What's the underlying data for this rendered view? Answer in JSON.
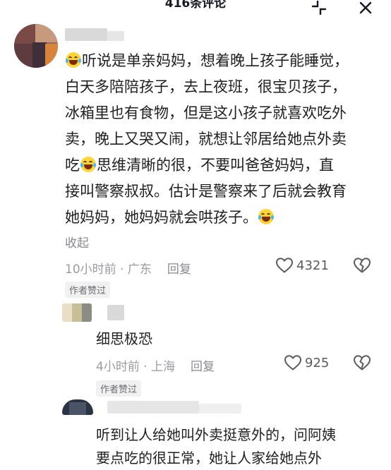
{
  "header": {
    "title": "416条评论"
  },
  "comments": [
    {
      "text_lines": [
        "听说是单亲妈妈，想着晚上孩子能睡觉，",
        "白天多陪陪孩子，去上夜班，很宝贝孩子，",
        "冰箱里也有食物，但是这小孩子就喜欢吃外",
        "卖，晚上又哭又闹，就想让邻居给她点外卖",
        "思维清晰的很，不要叫爸爸妈妈，直",
        "接叫警察叔叔。估计是警察来了后就会教育",
        "她妈妈，她妈妈就会哄孩子。"
      ],
      "text_line5_prefix": "吃",
      "collapse_label": "收起",
      "time": "10小时前",
      "location": "广东",
      "reply_label": "回复",
      "likes": "4321",
      "badge": "作者赞过"
    },
    {
      "text": "细思极恐",
      "time": "4小时前",
      "location": "上海",
      "reply_label": "回复",
      "likes": "925",
      "badge": "作者赞过"
    },
    {
      "text_lines": [
        "听到让人给她叫外卖挺意外的，问阿姨",
        "要点吃的很正常，她让人家给她点外"
      ]
    }
  ],
  "icons": [
    "minimize-icon",
    "close-icon",
    "heart-icon",
    "dislike-icon",
    "laugh-cry-emoji"
  ]
}
